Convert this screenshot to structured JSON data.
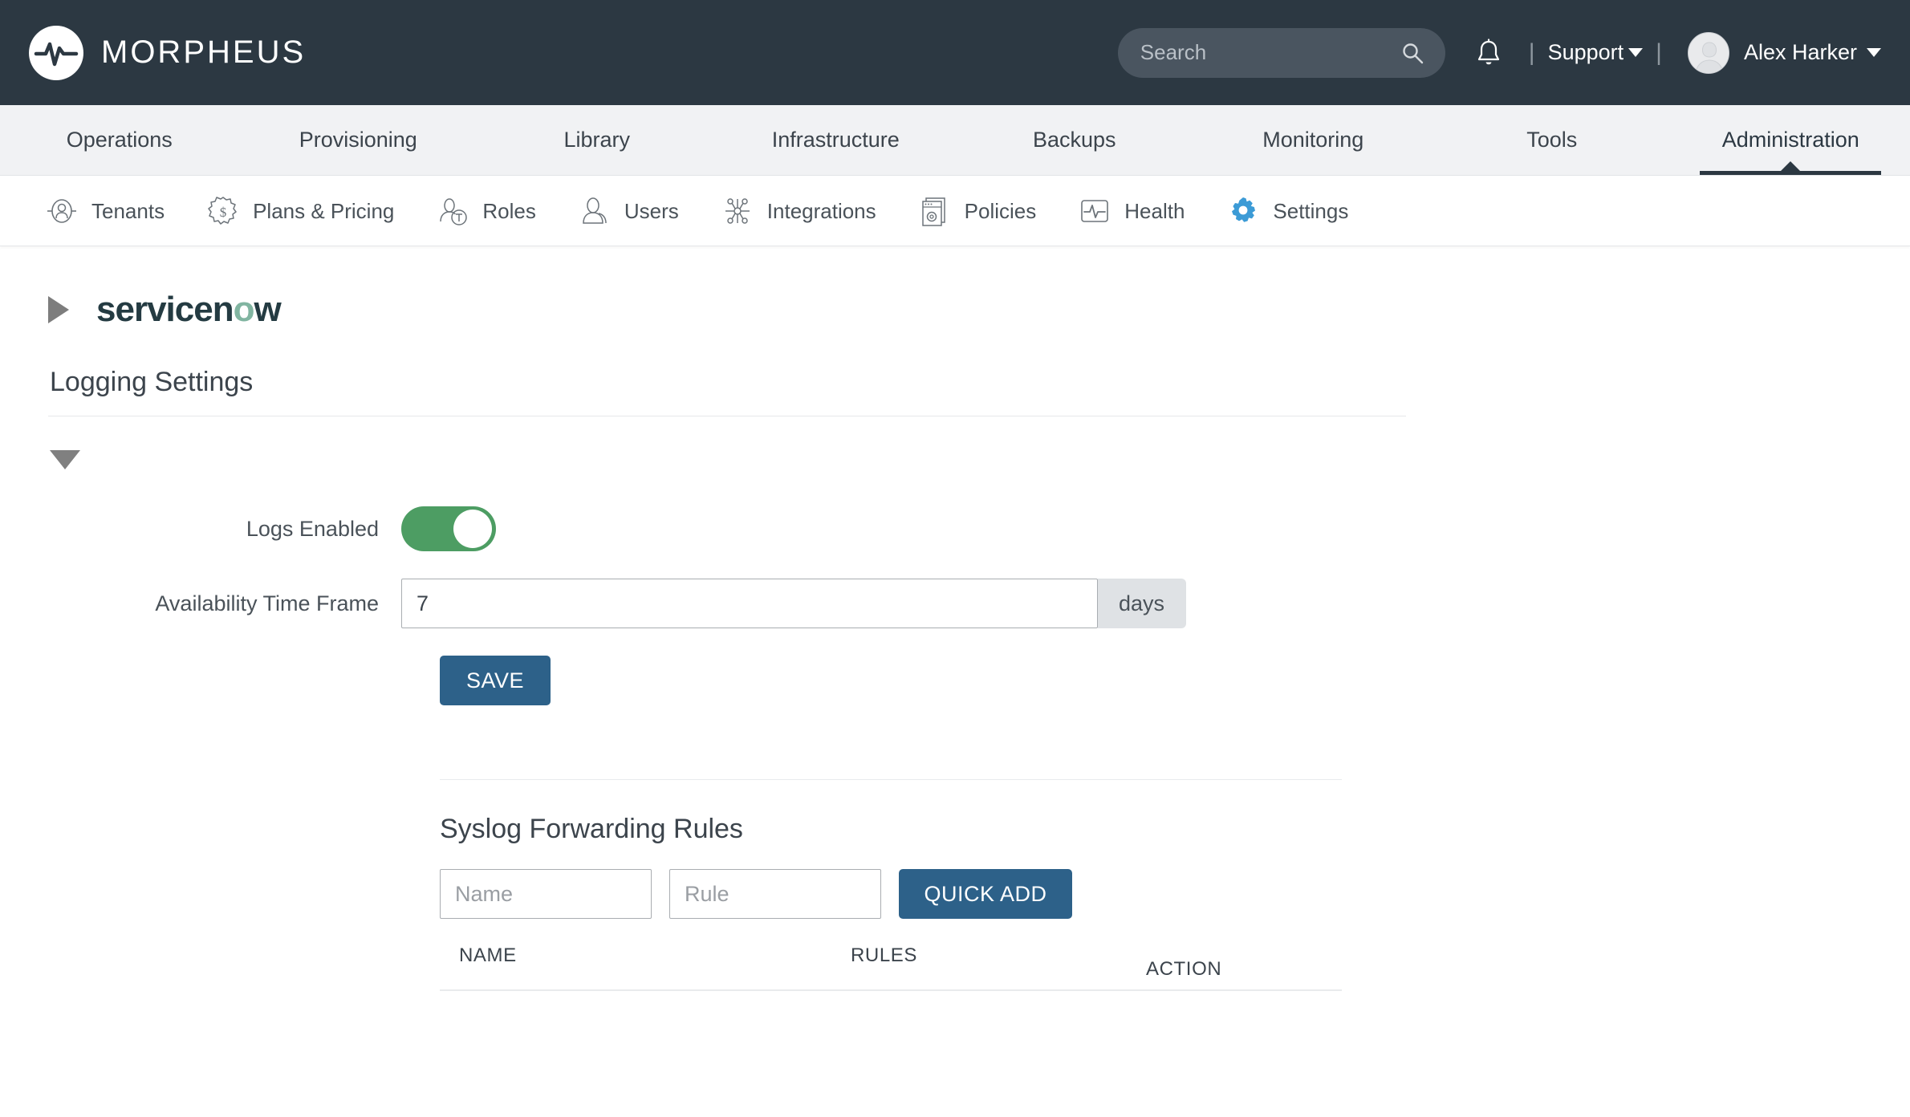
{
  "header": {
    "brand_name": "MORPHEUS",
    "brand_icon": "morpheus-logo-icon",
    "search": {
      "placeholder": "Search",
      "value": "",
      "icon": "search-icon"
    },
    "notifications_icon": "bell-icon",
    "divider": "|",
    "support_label": "Support",
    "user_name": "Alex Harker",
    "avatar_icon": "user-avatar"
  },
  "main_nav": {
    "items": [
      {
        "label": "Operations",
        "active": false
      },
      {
        "label": "Provisioning",
        "active": false
      },
      {
        "label": "Library",
        "active": false
      },
      {
        "label": "Infrastructure",
        "active": false
      },
      {
        "label": "Backups",
        "active": false
      },
      {
        "label": "Monitoring",
        "active": false
      },
      {
        "label": "Tools",
        "active": false
      },
      {
        "label": "Administration",
        "active": true
      }
    ]
  },
  "sub_nav": {
    "items": [
      {
        "label": "Tenants",
        "icon": "tenants-icon",
        "active": false
      },
      {
        "label": "Plans & Pricing",
        "icon": "plans-pricing-icon",
        "active": false
      },
      {
        "label": "Roles",
        "icon": "roles-icon",
        "active": false
      },
      {
        "label": "Users",
        "icon": "users-icon",
        "active": false
      },
      {
        "label": "Integrations",
        "icon": "integrations-icon",
        "active": false
      },
      {
        "label": "Policies",
        "icon": "policies-icon",
        "active": false
      },
      {
        "label": "Health",
        "icon": "health-icon",
        "active": false
      },
      {
        "label": "Settings",
        "icon": "settings-gear-icon",
        "active": true
      }
    ]
  },
  "page": {
    "servicenow_logo_part1": "servicen",
    "servicenow_logo_accent": "o",
    "servicenow_logo_part2": "w",
    "servicenow_collapse_icon": "triangle-right-icon",
    "section_title": "Logging Settings",
    "section_collapse_icon": "triangle-down-icon"
  },
  "logging_form": {
    "logs_enabled_label": "Logs Enabled",
    "logs_enabled_value": "on",
    "availability_label": "Availability Time Frame",
    "availability_value": "7",
    "availability_unit": "days",
    "save_label": "SAVE"
  },
  "syslog": {
    "title": "Syslog Forwarding Rules",
    "name_placeholder": "Name",
    "name_value": "",
    "rule_placeholder": "Rule",
    "rule_value": "",
    "quick_add_label": "QUICK ADD",
    "columns": {
      "name": "NAME",
      "rules": "RULES",
      "action": "ACTION"
    },
    "rows": []
  },
  "colors": {
    "header_bg": "#2c3842",
    "nav_bg": "#f1f2f4",
    "primary_button": "#2d6189",
    "toggle_on": "#4d9d63",
    "active_icon": "#3c9bd6",
    "servicenow_green": "#81b5a1"
  }
}
